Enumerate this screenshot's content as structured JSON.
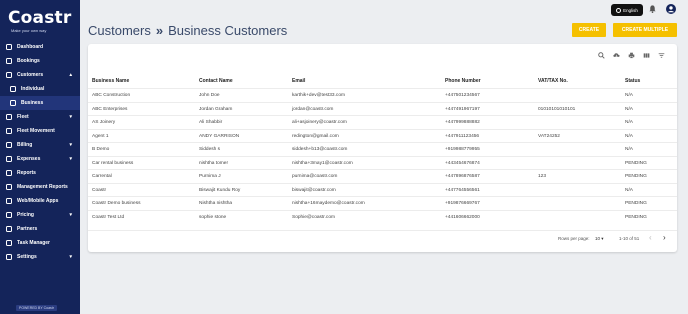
{
  "brand": {
    "name": "Coastr",
    "tagline": "Make your own way",
    "powered": "POWERED BY Coastr"
  },
  "header": {
    "title": "Customers",
    "separator": "»",
    "subtitle": "Business Customers",
    "language": "English"
  },
  "actions": {
    "create": "CREATE",
    "create_multiple": "CREATE MULTIPLE"
  },
  "sidebar": {
    "items": [
      {
        "label": "Dashboard",
        "icon": "dashboard-icon"
      },
      {
        "label": "Bookings",
        "icon": "bookings-icon"
      },
      {
        "label": "Customers",
        "icon": "customers-icon",
        "expanded": true
      },
      {
        "label": "Individual",
        "icon": "individual-icon",
        "sub": true
      },
      {
        "label": "Business",
        "icon": "business-icon",
        "sub": true,
        "active": true
      },
      {
        "label": "Fleet",
        "icon": "fleet-icon"
      },
      {
        "label": "Fleet Movement",
        "icon": "fleet-movement-icon"
      },
      {
        "label": "Billing",
        "icon": "billing-icon"
      },
      {
        "label": "Expenses",
        "icon": "expenses-icon"
      },
      {
        "label": "Reports",
        "icon": "reports-icon"
      },
      {
        "label": "Management Reports",
        "icon": "management-reports-icon"
      },
      {
        "label": "Web/Mobile Apps",
        "icon": "apps-icon"
      },
      {
        "label": "Pricing",
        "icon": "pricing-icon"
      },
      {
        "label": "Partners",
        "icon": "partners-icon"
      },
      {
        "label": "Task Manager",
        "icon": "task-manager-icon"
      },
      {
        "label": "Settings",
        "icon": "settings-icon"
      }
    ]
  },
  "table": {
    "columns": [
      "Business Name",
      "Contact Name",
      "Email",
      "Phone Number",
      "VAT/TAX No.",
      "Status"
    ],
    "rows": [
      [
        "ABC Construction",
        "John Doe",
        "karthik+dev@test33.com",
        "+447501234567",
        "",
        "N/A"
      ],
      [
        "ABC Enterprises",
        "Jordan Graham",
        "jordan@coastr.com",
        "+447491967197",
        "01010101010101",
        "N/A"
      ],
      [
        "AS Joinery",
        "Ali Shabbir",
        "ali+asjoinery@coastr.com",
        "+447999888882",
        "",
        "N/A"
      ],
      [
        "Agent 1",
        "ANDY GARRISON",
        "redington@gmail.com",
        "+447911123456",
        "VAT24252",
        "N/A"
      ],
      [
        "B Demo",
        "Siddesh s",
        "siddesh+b13@coastr.com",
        "+919988779955",
        "",
        "N/A"
      ],
      [
        "Car rental business",
        "nishtha tomer",
        "nishtha+3may1@coastr.com",
        "+443454676874",
        "",
        "PENDING"
      ],
      [
        "Carrental",
        "Purnima J",
        "purnima@coastr.com",
        "+447896876587",
        "123",
        "PENDING"
      ],
      [
        "Coastr",
        "Biswajit Kundu Roy",
        "biswajit@coastr.com",
        "+447764556561",
        "",
        "N/A"
      ],
      [
        "Coastr Demo business",
        "Nishtha nishtha",
        "nishtha+16maydemo@coastr.com",
        "+919876669767",
        "",
        "PENDING"
      ],
      [
        "Coastr Test Ltd",
        "sophie stone",
        "Sophie@coastr.com",
        "+441606662000",
        "",
        "PENDING"
      ]
    ],
    "rows_per_page_label": "Rows per page:",
    "rows_per_page": "10",
    "range": "1-10 of 51"
  },
  "colors": {
    "sidebar": "#14245a",
    "accent": "#f5c000"
  }
}
